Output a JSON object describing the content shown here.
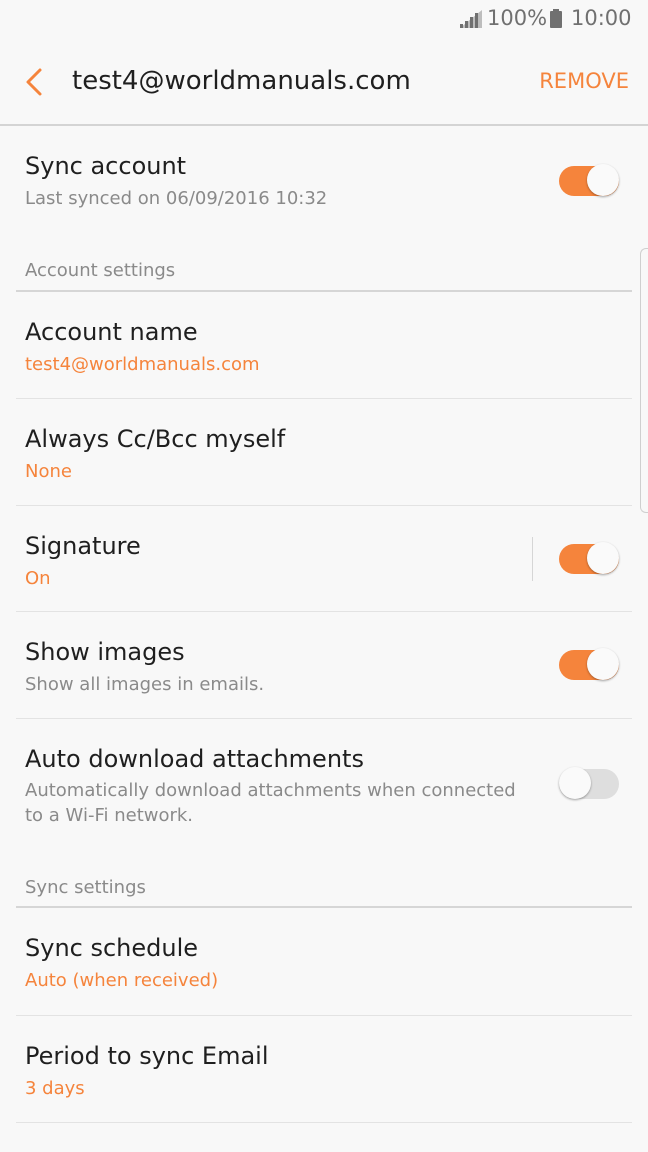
{
  "status_bar": {
    "battery_percent": "100%",
    "time": "10:00",
    "signal_icon": "signal-icon",
    "battery_icon": "battery-icon"
  },
  "app_bar": {
    "back_icon": "chevron-left-icon",
    "title": "test4@worldmanuals.com",
    "remove_label": "REMOVE"
  },
  "colors": {
    "accent": "#f5843c",
    "primary_text": "#1f1f1f",
    "secondary_text": "#8a8a8a",
    "background": "#f8f8f8"
  },
  "sync_account": {
    "label": "Sync account",
    "subtitle": "Last synced on 06/09/2016  10:32",
    "toggle_on": true
  },
  "account_settings": {
    "header": "Account settings",
    "items": [
      {
        "label": "Account name",
        "value": "test4@worldmanuals.com"
      },
      {
        "label": "Always Cc/Bcc myself",
        "value": "None"
      },
      {
        "label": "Signature",
        "value": "On",
        "toggle_on": true
      },
      {
        "label": "Show images",
        "value": "Show all images in emails.",
        "toggle_on": true
      },
      {
        "label": "Auto download attachments",
        "value_line1": "Automatically download attachments when connected",
        "value_line2": "to a Wi-Fi network.",
        "toggle_on": false
      }
    ]
  },
  "sync_settings": {
    "header": "Sync settings",
    "items": [
      {
        "label": "Sync schedule",
        "value": "Auto (when received)"
      },
      {
        "label": "Period to sync Email",
        "value": "3 days"
      }
    ]
  }
}
